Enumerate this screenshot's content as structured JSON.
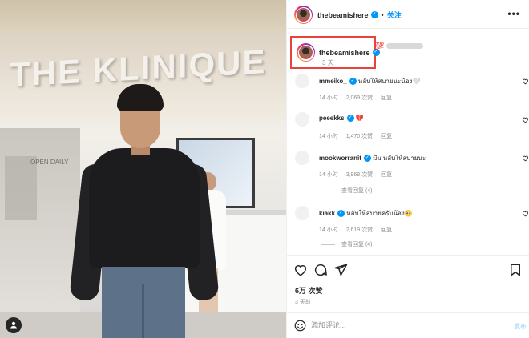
{
  "photo": {
    "store_sign": "THE KLINIQUE",
    "panel_text_1": "OPEN DAILY"
  },
  "post": {
    "author": "thebeamishere",
    "follow_label": "关注",
    "more_glyph": "•••",
    "separator": "•",
    "caption_time": "3 天",
    "caption_emoji": "💯",
    "likes": "6万 次赞",
    "date": "3 天前"
  },
  "comments": [
    {
      "user": "mmeiko_",
      "verified": true,
      "text": "หลับให้สบายนะน้อง🤍",
      "time": "14 小时",
      "likes": "2,069 次赞",
      "reply": "回复",
      "view_replies": ""
    },
    {
      "user": "peeekks",
      "verified": true,
      "text": "💔",
      "time": "14 小时",
      "likes": "1,470 次赞",
      "reply": "回复",
      "view_replies": ""
    },
    {
      "user": "mookworranit",
      "verified": true,
      "text": "มีม หลับให้สบายนะ",
      "time": "14 小时",
      "likes": "3,968 次赞",
      "reply": "回复",
      "view_replies": "查看回复 (4)"
    },
    {
      "user": "kiakk",
      "verified": true,
      "text": "หลับให้สบายครับน้อง🥺",
      "time": "14 小时",
      "likes": "2,619 次赞",
      "reply": "回复",
      "view_replies": "查看回复 (4)"
    }
  ],
  "add_comment": {
    "placeholder": "添加评论...",
    "post_label": "发布"
  },
  "icons": [
    "heart-icon",
    "comment-icon",
    "share-icon",
    "bookmark-icon",
    "emoji-icon",
    "user-tag-icon"
  ],
  "colors": {
    "accent": "#0095f6",
    "highlight_box": "#e8423a",
    "muted": "#8e8e8e"
  }
}
